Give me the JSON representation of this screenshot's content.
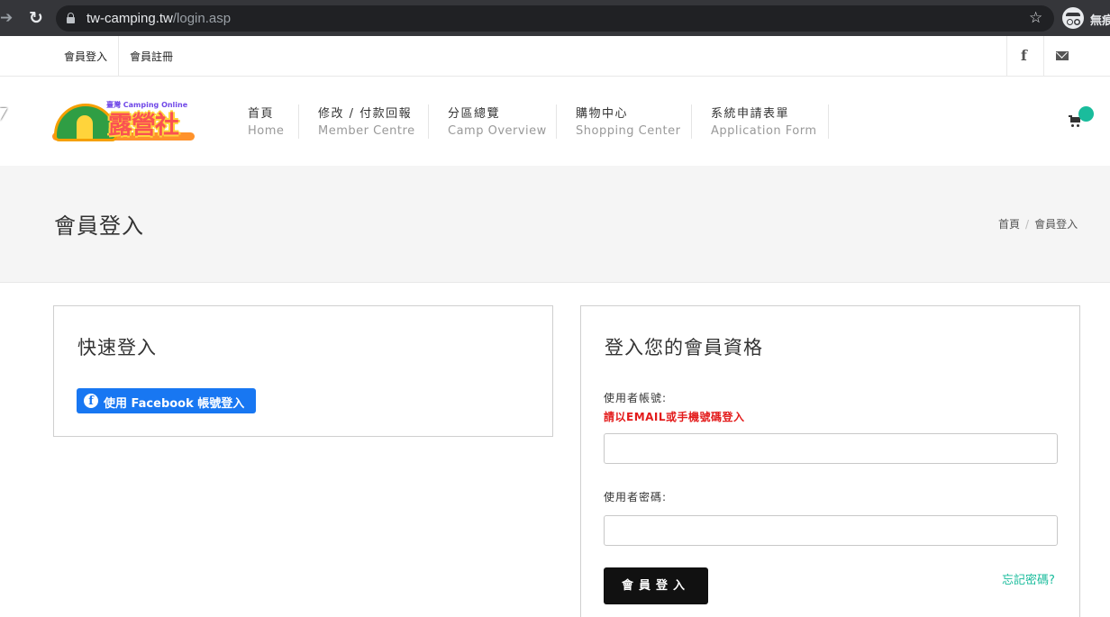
{
  "browser": {
    "url_host": "tw-camping.tw",
    "url_path": "/login.asp",
    "incognito_label": "無痕"
  },
  "topbar": {
    "login": "會員登入",
    "register": "會員註冊",
    "facebook_glyph": "f"
  },
  "logo": {
    "brand": "露營社",
    "small": "臺灣 Camping Online"
  },
  "menu": [
    {
      "zh": "首頁",
      "en": "Home"
    },
    {
      "zh": "修改 / 付款回報",
      "en": "Member Centre"
    },
    {
      "zh": "分區總覽",
      "en": "Camp Overview"
    },
    {
      "zh": "購物中心",
      "en": "Shopping Center"
    },
    {
      "zh": "系統申請表單",
      "en": "Application Form"
    }
  ],
  "page": {
    "title": "會員登入",
    "breadcrumb": [
      "首頁",
      "會員登入"
    ],
    "breadcrumb_sep": "/"
  },
  "quick_login": {
    "title": "快速登入",
    "fb_button": "使用 Facebook 帳號登入"
  },
  "member_login": {
    "title": "登入您的會員資格",
    "username_label": "使用者帳號:",
    "username_hint": "請以EMAIL或手機號碼登入",
    "password_label": "使用者密碼:",
    "submit": "會員登入",
    "forgot": "忘記密碼?"
  },
  "colors": {
    "accent": "#1abc9c",
    "facebook": "#1877f2",
    "hint_red": "#e31b1b"
  }
}
